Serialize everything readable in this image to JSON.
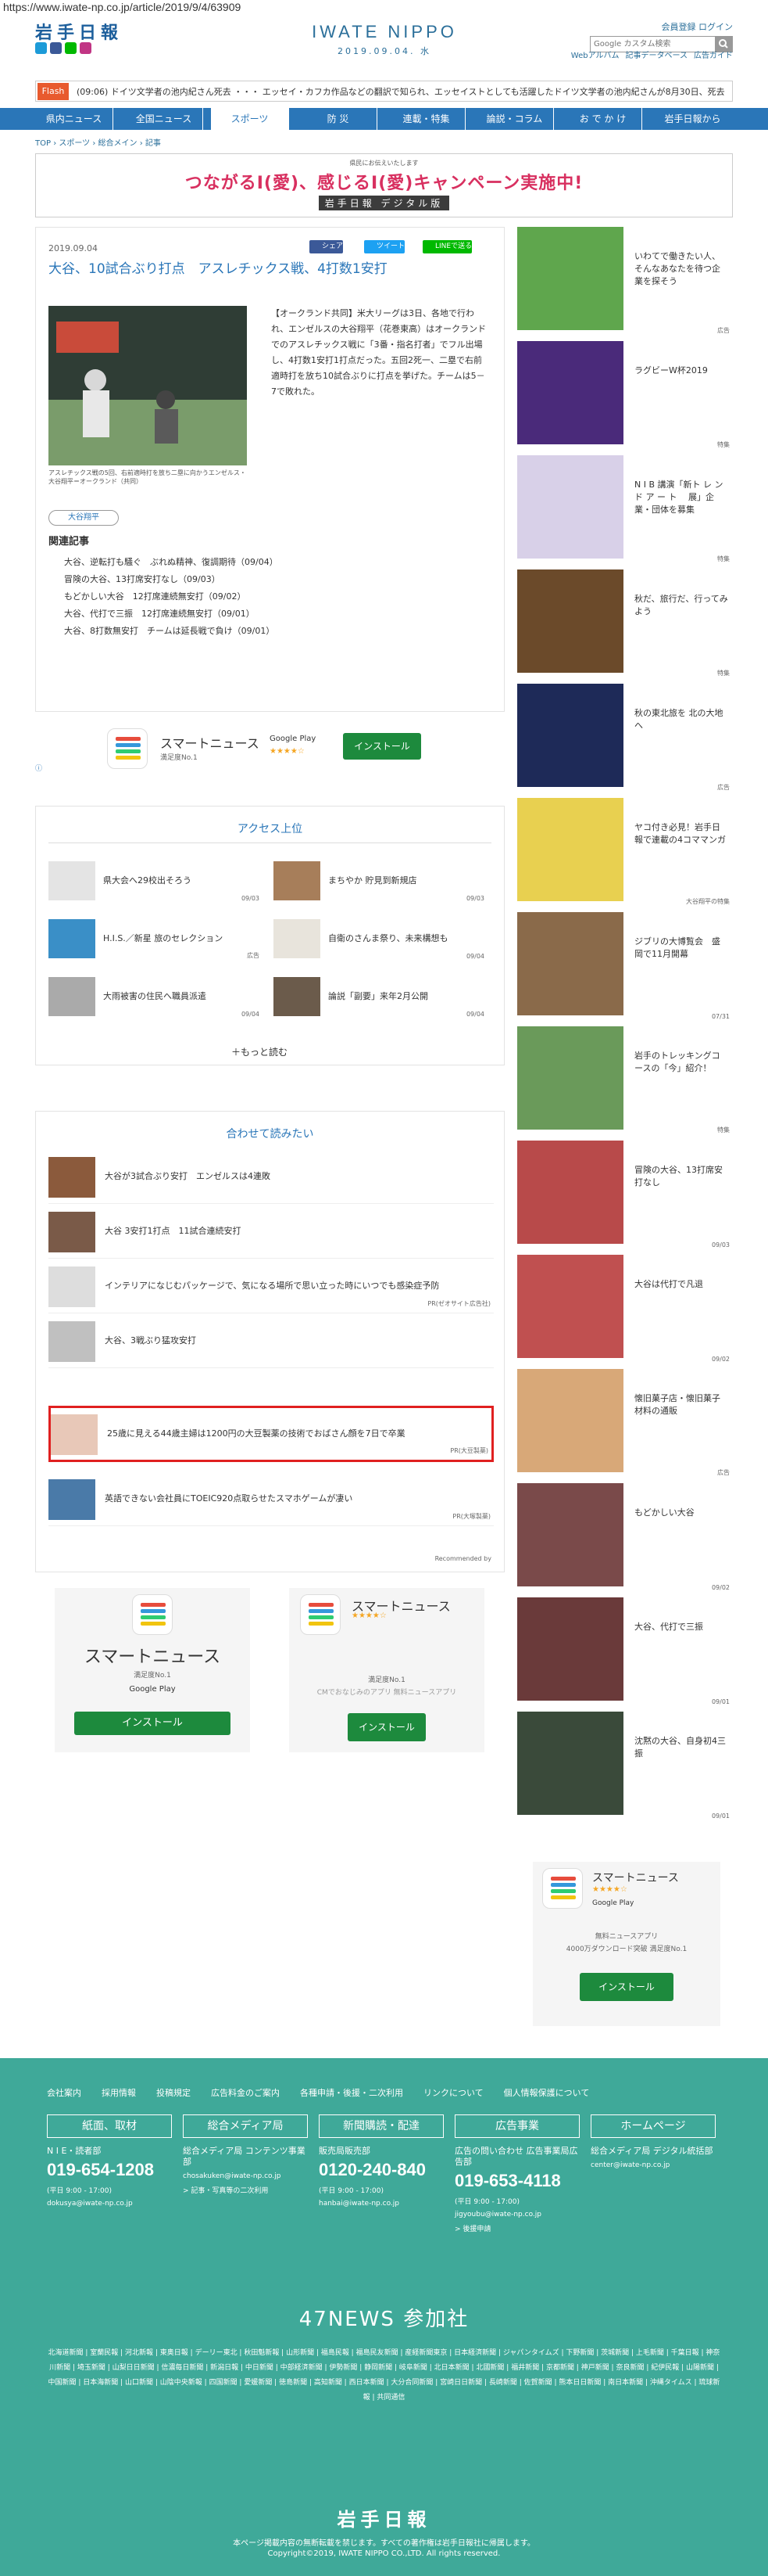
{
  "url": "https://www.iwate-np.co.jp/article/2019/9/4/63909",
  "header": {
    "logo": "岩手日報",
    "site_name": "IWATE NIPPO",
    "date": "2019.09.04. 水",
    "login": "会員登録  ログイン",
    "search_placeholder": "Google カスタム検索",
    "sublinks": [
      "Webアルバム",
      "記事データベース",
      "広告ガイド"
    ]
  },
  "flash": {
    "label": "Flash",
    "text": "(09:06) ドイツ文学者の池内紀さん死去 ・・・ エッセイ・カフカ作品などの翻訳で知られ、エッセイストとしても活躍したドイツ文学者の池内紀さんが8月30日、死去し・・・"
  },
  "nav": [
    "県内ニュース",
    "全国ニュース",
    "スポーツ",
    "防 災",
    "連載・特集",
    "論説・コラム",
    "お で か け",
    "岩手日報から"
  ],
  "breadcrumb": "TOP › スポーツ › 総合メイン › 記事",
  "banner": {
    "small": "県民にお伝えいたします",
    "big": "つながるI(愛)、感じるI(愛)キャンペーン実施中!",
    "tag": "岩手日報 デジタル版"
  },
  "article": {
    "date": "2019.09.04",
    "share": [
      "シェア",
      "ツイート",
      "LINEで送る"
    ],
    "title": "大谷、10試合ぶり打点　アスレチックス戦、4打数1安打",
    "caption": "アスレチックス戦の5回、右前適時打を放ち二塁に向かうエンゼルス・大谷翔平＝オークランド（共同）",
    "body": "【オークランド共同】米大リーグは3日、各地で行われ、エンゼルスの大谷翔平（花巻東高）はオークランドでのアスレチックス戦に「3番・指名打者」でフル出場し、4打数1安打1打点だった。五回2死一、二塁で右前適時打を放ち10試合ぶりに打点を挙げた。チームは5－7で敗れた。",
    "tag": "大谷翔平",
    "related_heading": "関連記事",
    "related": [
      "大谷、逆転打も騒ぐ　ぶれぬ精神、復調期待（09/04）",
      "冒険の大谷、13打席安打なし（09/03）",
      "もどかしい大谷　12打席連続無安打（09/02）",
      "大谷、代打で三振　12打席連続無安打（09/01）",
      "大谷、8打数無安打　チームは延長戦で負け（09/01）"
    ]
  },
  "ad_smartnews": {
    "title": "スマートニュース",
    "sub": "満足度No.1",
    "store": "Google Play",
    "install": "インストール"
  },
  "access": {
    "title": "アクセス上位",
    "items": [
      {
        "text": "県大会へ29校出そろう",
        "date": "09/03"
      },
      {
        "text": "まちやか 貯見到新規店",
        "date": "09/03"
      },
      {
        "text": "H.I.S.／新星 旅のセレクション",
        "date": "広告"
      },
      {
        "text": "自衛のさんま祭り、未来構想も",
        "date": "09/04"
      },
      {
        "text": "大雨被害の住民へ職員派遣",
        "date": "09/04"
      },
      {
        "text": "論説「副要」来年2月公開",
        "date": "09/04"
      }
    ],
    "more": "＋もっと読む"
  },
  "recommend": {
    "title": "合わせて読みたい",
    "items": [
      {
        "text": "大谷が3試合ぶり安打　エンゼルスは4連敗",
        "pr": ""
      },
      {
        "text": "大谷 3安打1打点　11試合連続安打",
        "pr": ""
      },
      {
        "text": "インテリアになじむパッケージで、気になる場所で思い立った時にいつでも感染症予防",
        "pr": "PR(ゼオサイト広告社)"
      },
      {
        "text": "大谷、3戦ぶり猛攻安打",
        "pr": ""
      },
      {
        "text": "25歳に見える44歳主婦は1200円の大豆製薬の技術でおばさん顔を7日で卒業",
        "pr": "PR(大豆製薬)"
      },
      {
        "text": "英語できない会社員にTOEIC920点取らせたスマホゲームが凄い",
        "pr": "PR(大塚製薬)"
      }
    ],
    "credit": "Recommended by"
  },
  "ad_row": {
    "left_title": "スマートニュース",
    "left_sub": "満足度No.1",
    "left_store": "Google Play",
    "left_install": "インストール",
    "right_title": "スマートニュース",
    "right_sub": "満足度No.1",
    "right_desc": "CMでおなじみのアプリ 無料ニュースアプリ",
    "right_install": "インストール"
  },
  "sidebar": [
    {
      "text": "いわてで働きたい人、そんなあなたを待つ企業を探そう",
      "date": "広告"
    },
    {
      "text": "ラグビーW杯2019",
      "date": "特集"
    },
    {
      "text": "N I B 講演「新ト レ ン ド ア ー ト　 展」企業・団体を募集",
      "date": "特集"
    },
    {
      "text": "秋だ、旅行だ、行ってみよう",
      "date": "特集"
    },
    {
      "text": "秋の東北旅を 北の大地へ",
      "date": "広告"
    },
    {
      "text": "ヤコ付き必見！岩手日報で連載の4コママンガ",
      "date": "大谷翔平の特集"
    },
    {
      "text": "ジブリの大博覧会　盛岡で11月開幕",
      "date": "07/31"
    },
    {
      "text": "岩手のトレッキングコースの「今」紹介！",
      "date": "特集"
    },
    {
      "text": "冒険の大谷、13打席安打なし",
      "date": "09/03"
    },
    {
      "text": "大谷は代打で凡退",
      "date": "09/02"
    },
    {
      "text": "懐旧菓子店・懐旧菓子材料の通販",
      "date": "広告"
    },
    {
      "text": "もどかしい大谷",
      "date": "09/02"
    },
    {
      "text": "大谷、代打で三振",
      "date": "09/01"
    },
    {
      "text": "沈黙の大谷、自身初4三振",
      "date": "09/01"
    }
  ],
  "side_ad": {
    "title": "スマートニュース",
    "store": "Google Play",
    "desc1": "無料ニュースアプリ",
    "desc2": "4000万ダウンロード突破 満足度No.1",
    "install": "インストール"
  },
  "footer": {
    "links": [
      "会社案内",
      "採用情報",
      "投稿規定",
      "広告料金のご案内",
      "各種申請・後援・二次利用",
      "リンクについて",
      "個人情報保護について"
    ],
    "cols": [
      {
        "head": "紙面、取材",
        "sub": "N I E・読者部",
        "phone": "019-654-1208",
        "hours": "(平日 9:00 - 17:00)",
        "mail": "dokusya@iwate-np.co.jp"
      },
      {
        "head": "総合メディア局",
        "sub": "総合メディア局 コンテンツ事業部",
        "phone": "",
        "hours": "",
        "mail": "chosakuken@iwate-np.co.jp"
      },
      {
        "head": "新聞購読・配達",
        "sub": "販売局販売部",
        "phone": "0120-240-840",
        "hours": "(平日 9:00 - 17:00)",
        "mail": "hanbai@iwate-np.co.jp"
      },
      {
        "head": "広告事業",
        "sub": "広告の問い合わせ 広告事業局広告部",
        "phone": "019-653-4118",
        "hours": "(平日 9:00 - 17:00)",
        "mail": "jigyoubu@iwate-np.co.jp"
      },
      {
        "head": "ホームページ",
        "sub": "総合メディア局 デジタル統括部",
        "phone": "",
        "hours": "",
        "mail": "center@iwate-np.co.jp"
      }
    ],
    "link_extra1": "> 記事・写真等の二次利用",
    "link_extra2": "> 後援申請",
    "news47": "47NEWS 参加社",
    "members": "北海道新聞 | 室蘭民報 | 河北新報 | 東奥日報 | デーリー東北 | 秋田魁新報 | 山形新聞 | 福島民報 | 福島民友新聞 | 産経新聞東京 | 日本経済新聞 | ジャパンタイムズ | 下野新聞 | 茨城新聞 | 上毛新聞 | 千葉日報 | 神奈川新聞 | 埼玉新聞 | 山梨日日新聞 | 信濃毎日新聞 | 新潟日報 | 中日新聞 | 中部経済新聞 | 伊勢新聞 | 静岡新聞 | 岐阜新聞 | 北日本新聞 | 北國新聞 | 福井新聞 | 京都新聞 | 神戸新聞 | 奈良新聞 | 紀伊民報 | 山陽新聞 | 中国新聞 | 日本海新聞 | 山口新聞 | 山陰中央新報 | 四国新聞 | 愛媛新聞 | 徳島新聞 | 高知新聞 | 西日本新聞 | 大分合同新聞 | 宮崎日日新聞 | 長崎新聞 | 佐賀新聞 | 熊本日日新聞 | 南日本新聞 | 沖縄タイムス | 琉球新報 | 共同通信",
    "logo": "岩手日報",
    "copy1": "本ページ掲載内容の無断転載を禁じます。すべての著作権は岩手日報社に帰属します。",
    "copy2": "Copyright©2019, IWATE NIPPO CO.,LTD. All rights reserved."
  },
  "colors": {
    "brand": "#2a76b8",
    "footer": "#3fa999",
    "flash": "#e85a2e",
    "highlight": "#e02020"
  }
}
